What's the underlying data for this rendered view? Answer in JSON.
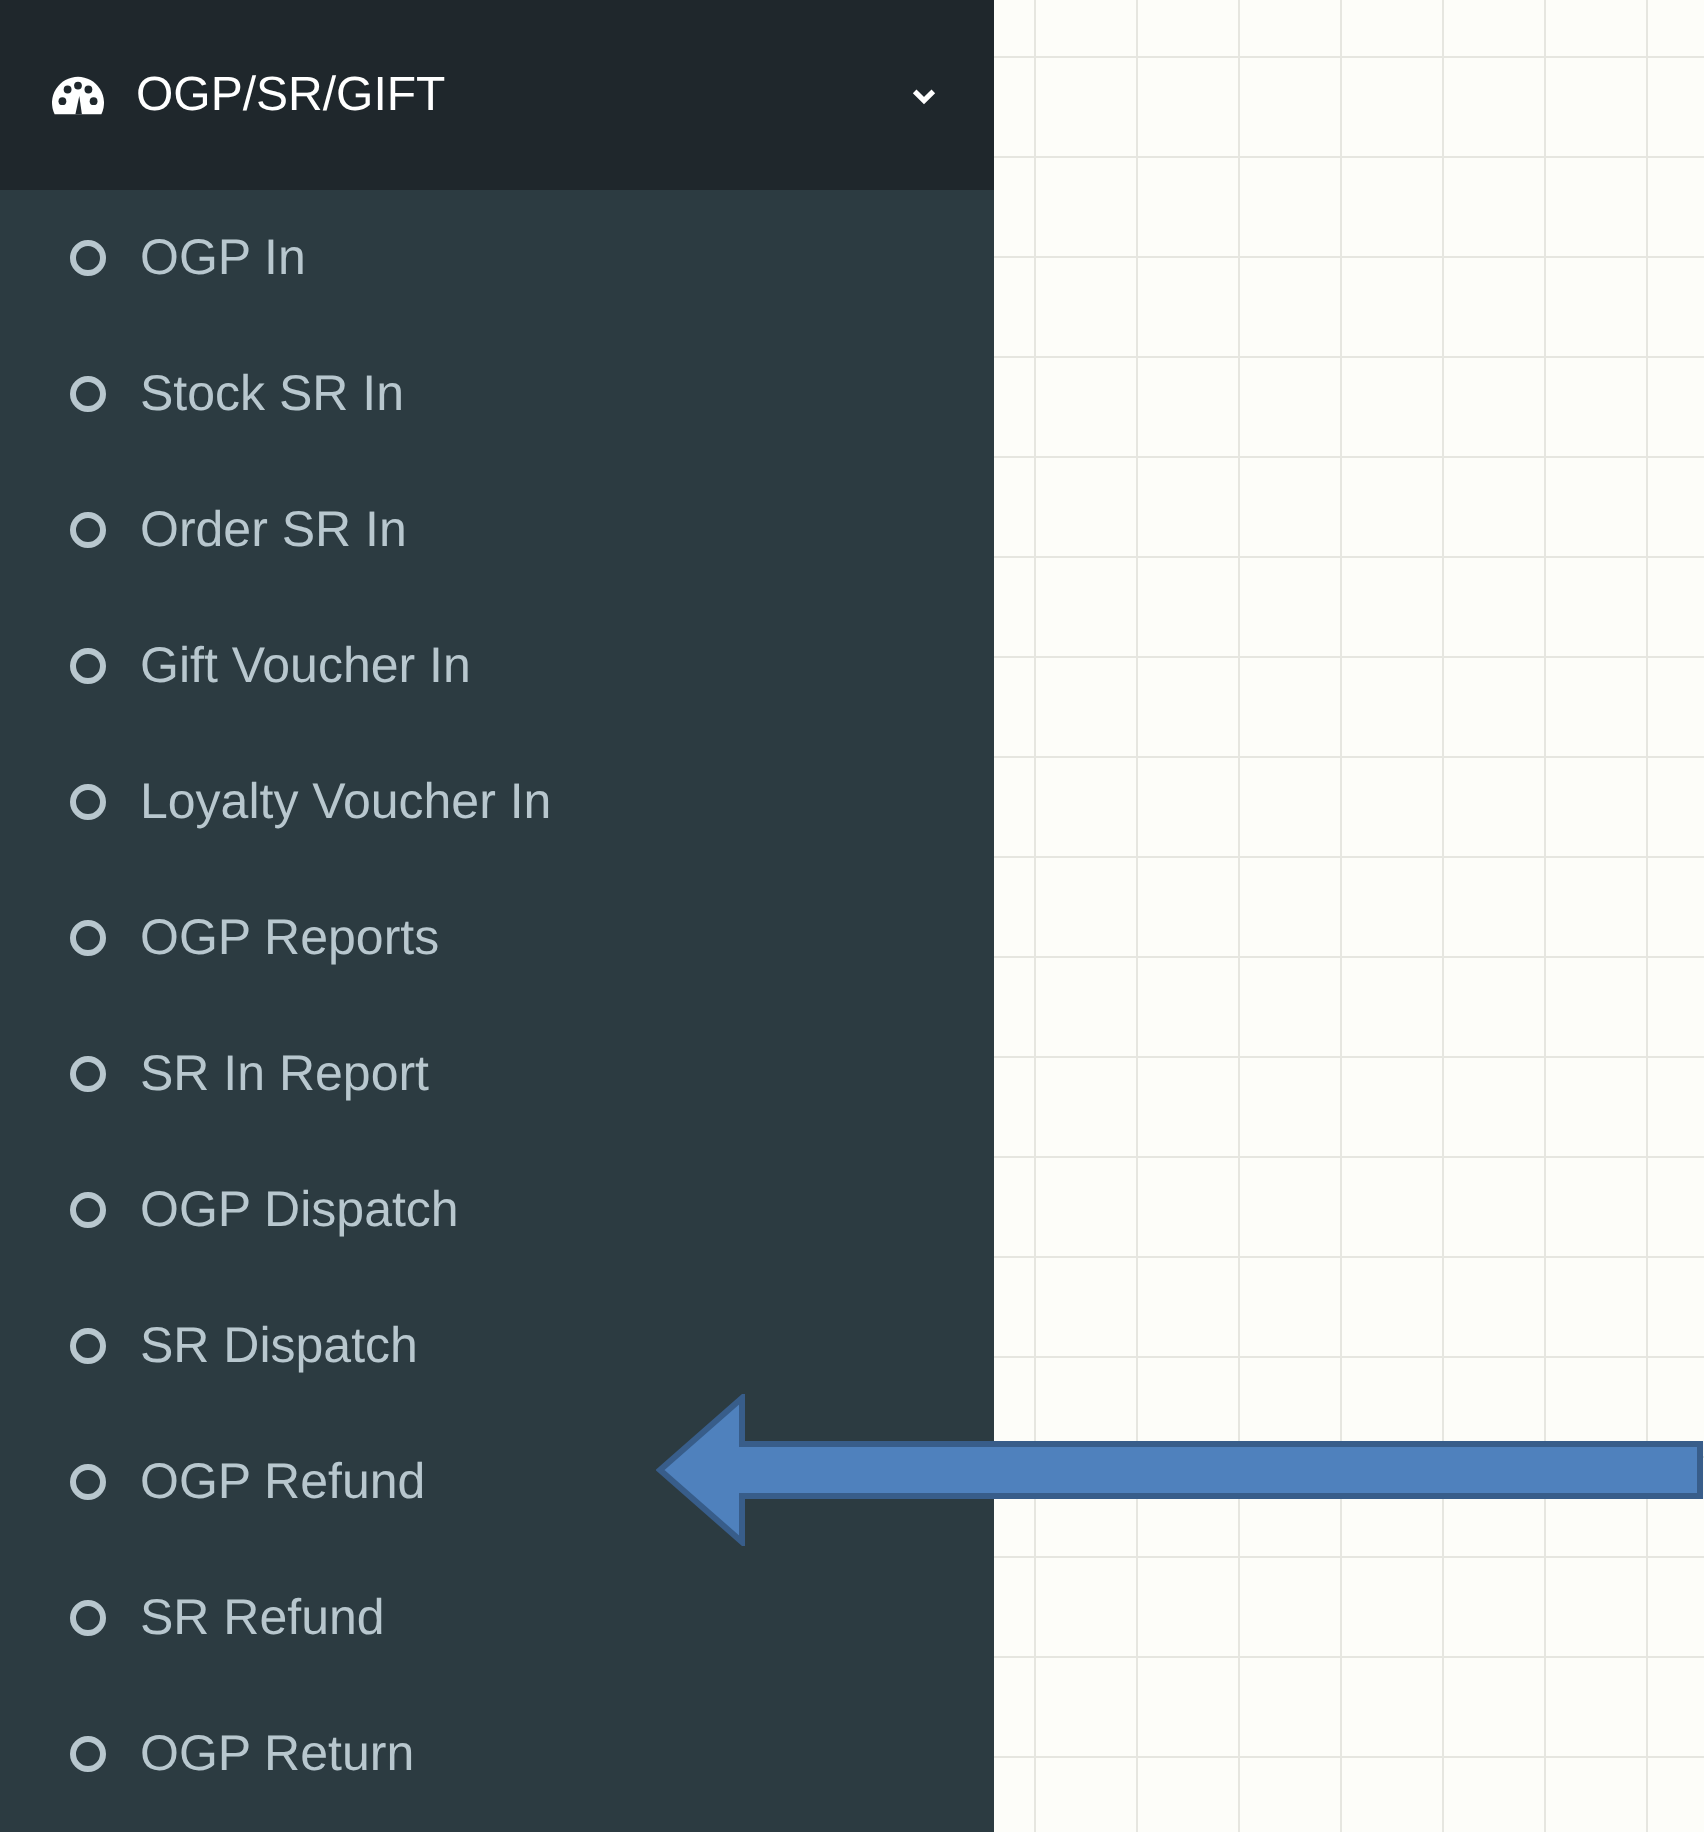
{
  "sidebar": {
    "header": {
      "label": "OGP/SR/GIFT",
      "expanded": true
    },
    "items": [
      {
        "label": "OGP In"
      },
      {
        "label": "Stock SR In"
      },
      {
        "label": "Order SR In"
      },
      {
        "label": "Gift Voucher In"
      },
      {
        "label": "Loyalty Voucher In"
      },
      {
        "label": "OGP Reports"
      },
      {
        "label": "SR In Report"
      },
      {
        "label": "OGP Dispatch"
      },
      {
        "label": "SR Dispatch"
      },
      {
        "label": "OGP Refund"
      },
      {
        "label": "SR Refund"
      },
      {
        "label": "OGP Return"
      }
    ]
  }
}
